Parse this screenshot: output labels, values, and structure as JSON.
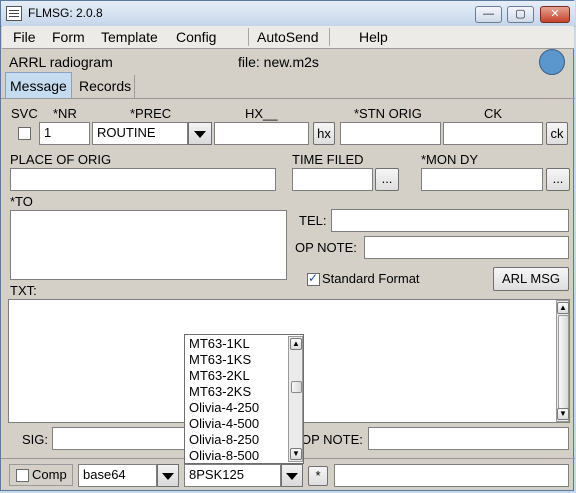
{
  "window": {
    "title": "FLMSG: 2.0.8",
    "min_glyph": "—",
    "max_glyph": "▢",
    "close_glyph": "✕"
  },
  "menu": {
    "items": [
      "File",
      "Form",
      "Template",
      "Config",
      "AutoSend",
      "Help"
    ]
  },
  "header": {
    "form_name": "ARRL radiogram",
    "file_label": "file: new.m2s"
  },
  "tabs": [
    "Message",
    "Records"
  ],
  "fields": {
    "svc": {
      "label": "SVC"
    },
    "nr": {
      "label": "*NR",
      "value": "1"
    },
    "prec": {
      "label": "*PREC",
      "value": "ROUTINE"
    },
    "hx": {
      "label": "HX__",
      "value": "",
      "button": "hx"
    },
    "stn_orig": {
      "label": "*STN ORIG",
      "value": ""
    },
    "ck": {
      "label": "CK",
      "value": "",
      "button": "ck"
    },
    "place_of_orig": {
      "label": "PLACE OF ORIG",
      "value": ""
    },
    "time_filed": {
      "label": "TIME FILED",
      "value": "",
      "button": "..."
    },
    "mon_dy": {
      "label": "*MON DY",
      "value": "",
      "button": "..."
    },
    "to": {
      "label": "*TO",
      "value": ""
    },
    "tel": {
      "label": "TEL:",
      "value": ""
    },
    "op_note": {
      "label": "OP NOTE:",
      "value": ""
    },
    "standard_format": {
      "label": "Standard Format",
      "checked": true
    },
    "arl_msg": {
      "button": "ARL MSG"
    },
    "txt": {
      "label": "TXT:",
      "value": ""
    },
    "sig": {
      "label": "SIG:",
      "value": ""
    },
    "op_note2": {
      "label": "OP NOTE:",
      "value": ""
    }
  },
  "bottom": {
    "comp_label": "Comp",
    "encoding": "base64",
    "mode": "8PSK125",
    "star_button": "*",
    "status": ""
  },
  "mode_dropdown": {
    "options": [
      "MT63-1KL",
      "MT63-1KS",
      "MT63-2KL",
      "MT63-2KS",
      "Olivia-4-250",
      "Olivia-4-500",
      "Olivia-8-250",
      "Olivia-8-500"
    ]
  },
  "colors": {
    "status_indicator": "#5b96cc",
    "window_bg": "#d4d0c8"
  }
}
